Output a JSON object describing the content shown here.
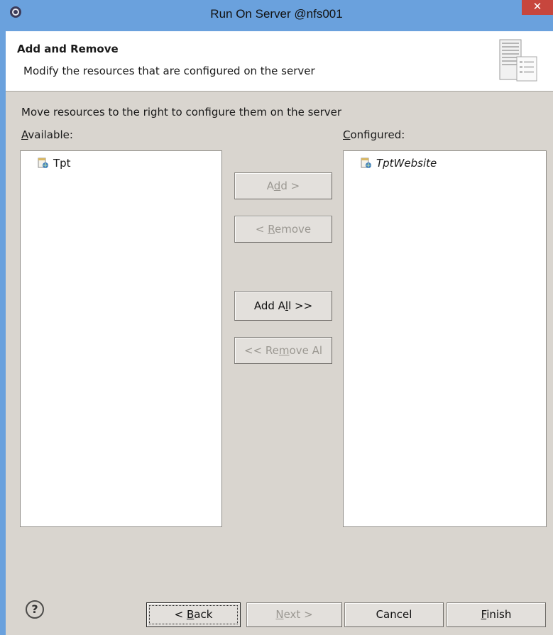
{
  "window": {
    "title": "Run On Server @nfs001",
    "close_label": "✕",
    "accent_color": "#6aa1dd",
    "close_color": "#c7463d"
  },
  "header": {
    "title": "Add and Remove",
    "description": "Modify the resources that are configured on the server",
    "image_icon": "server-resources-icon"
  },
  "main": {
    "instructions": "Move resources to the right to configure them on the server",
    "available_label_mnemonic": "A",
    "available_label_rest": "vailable:",
    "configured_label_mnemonic": "C",
    "configured_label_rest": "onfigured:",
    "available_items": [
      {
        "label": "Tpt",
        "icon": "web-module-icon"
      }
    ],
    "configured_items": [
      {
        "label": "TptWebsite",
        "icon": "web-module-icon"
      }
    ]
  },
  "buttons": {
    "add": {
      "pre": "A",
      "mnemonic": "d",
      "post": "d >",
      "enabled": false
    },
    "remove": {
      "pre": "< ",
      "mnemonic": "R",
      "post": "emove",
      "enabled": false
    },
    "add_all": {
      "pre": "Add A",
      "mnemonic": "l",
      "post": "l >>",
      "enabled": true
    },
    "remove_all": {
      "pre": "<< Re",
      "mnemonic": "m",
      "post": "ove Al",
      "enabled": false
    }
  },
  "footer": {
    "help_label": "?",
    "back": {
      "pre": "< ",
      "mnemonic": "B",
      "post": "ack"
    },
    "next": {
      "pre": "",
      "mnemonic": "N",
      "post": "ext >"
    },
    "cancel": "Cancel",
    "finish": {
      "pre": "",
      "mnemonic": "F",
      "post": "inish"
    }
  }
}
